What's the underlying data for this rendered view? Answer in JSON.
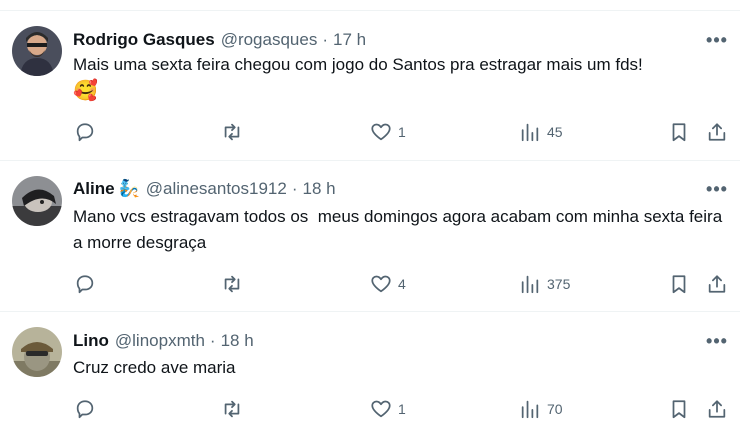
{
  "tweets": [
    {
      "name": "Rodrigo Gasques",
      "badge": "",
      "handle": "@rogasques",
      "separator": "·",
      "time": "17 h",
      "text": "Mais uma sexta feira chegou com jogo do Santos pra estragar mais um fds!",
      "emoji": "🥰",
      "reply_count": "",
      "retweet_count": "",
      "like_count": "1",
      "views_count": "45"
    },
    {
      "name": "Aline",
      "badge": "🧞",
      "handle": "@alinesantos1912",
      "separator": "·",
      "time": "18 h",
      "text": "Mano vcs estragavam todos os  meus domingos agora acabam com minha sexta feira a morre desgraça",
      "emoji": "",
      "reply_count": "",
      "retweet_count": "",
      "like_count": "4",
      "views_count": "375"
    },
    {
      "name": "Lino",
      "badge": "",
      "handle": "@linopxmth",
      "separator": "·",
      "time": "18 h",
      "text": "Cruz credo ave maria",
      "emoji": "",
      "reply_count": "",
      "retweet_count": "",
      "like_count": "1",
      "views_count": "70"
    }
  ],
  "more_label": "•••",
  "icons": {
    "reply": "reply-icon",
    "retweet": "retweet-icon",
    "like": "like-icon",
    "views": "views-icon",
    "bookmark": "bookmark-icon",
    "share": "share-icon"
  }
}
